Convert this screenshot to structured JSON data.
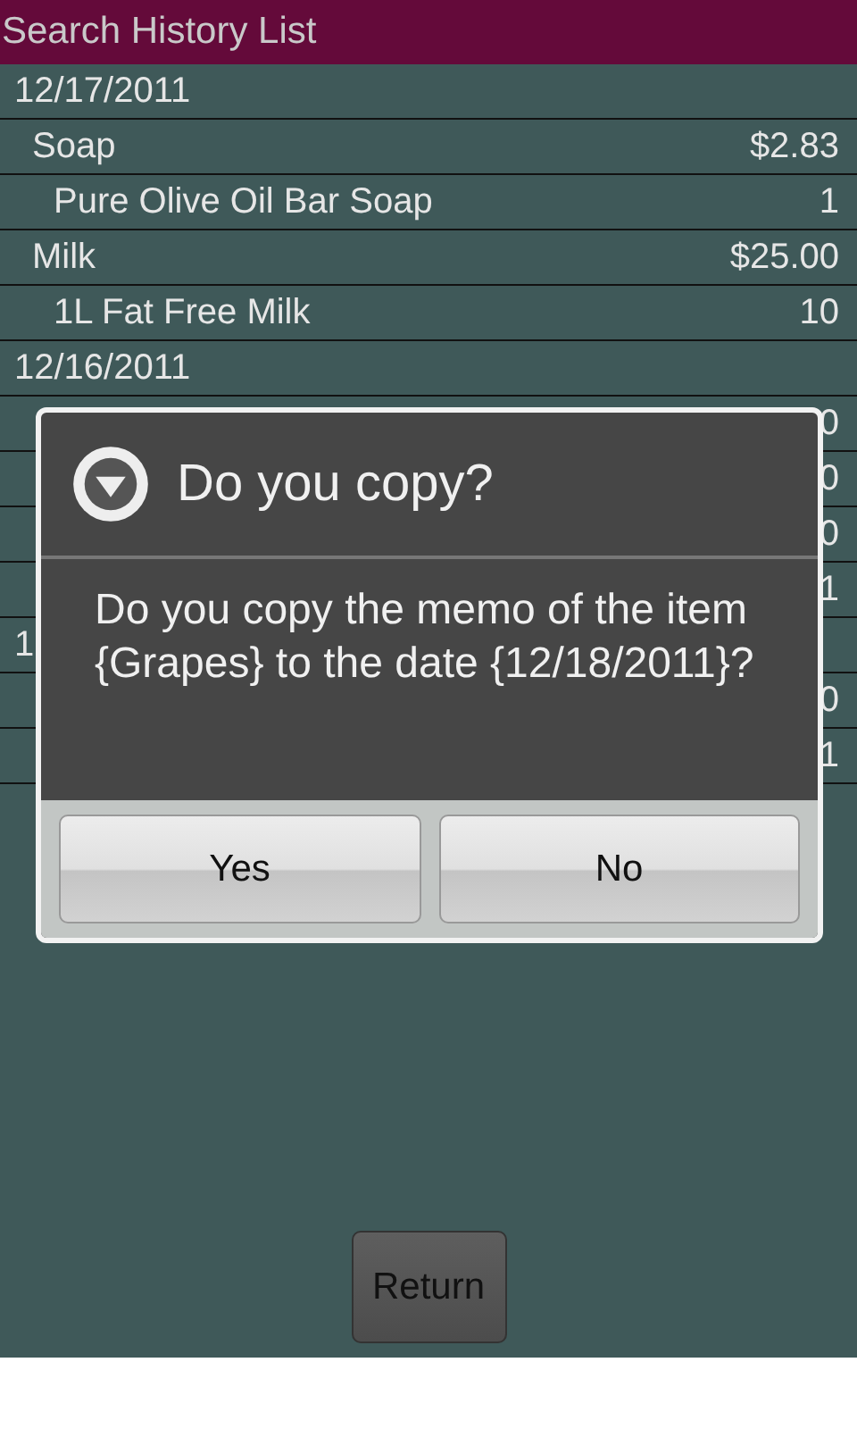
{
  "header": {
    "title": "Search History List"
  },
  "rows": [
    {
      "kind": "date",
      "name": "12/17/2011"
    },
    {
      "kind": "item",
      "name": "Soap",
      "value": "$2.83"
    },
    {
      "kind": "detail",
      "name": "Pure Olive Oil Bar Soap",
      "value": "1"
    },
    {
      "kind": "item",
      "name": "Milk",
      "value": "$25.00"
    },
    {
      "kind": "detail",
      "name": "1L Fat Free Milk",
      "value": "10"
    },
    {
      "kind": "date",
      "name": "12/16/2011"
    },
    {
      "kind": "item",
      "value": "0"
    },
    {
      "kind": "detail",
      "value": "0"
    },
    {
      "kind": "item",
      "value": "0"
    },
    {
      "kind": "detail",
      "value": "1"
    },
    {
      "kind": "date",
      "name": "1"
    },
    {
      "kind": "item",
      "value": "0"
    },
    {
      "kind": "detail",
      "value": "1"
    }
  ],
  "dialog": {
    "title": "Do you copy?",
    "message": "Do you copy the memo of the item {Grapes} to the date {12/18/2011}?",
    "buttons": [
      "Yes",
      "No"
    ]
  },
  "return_button": "Return"
}
